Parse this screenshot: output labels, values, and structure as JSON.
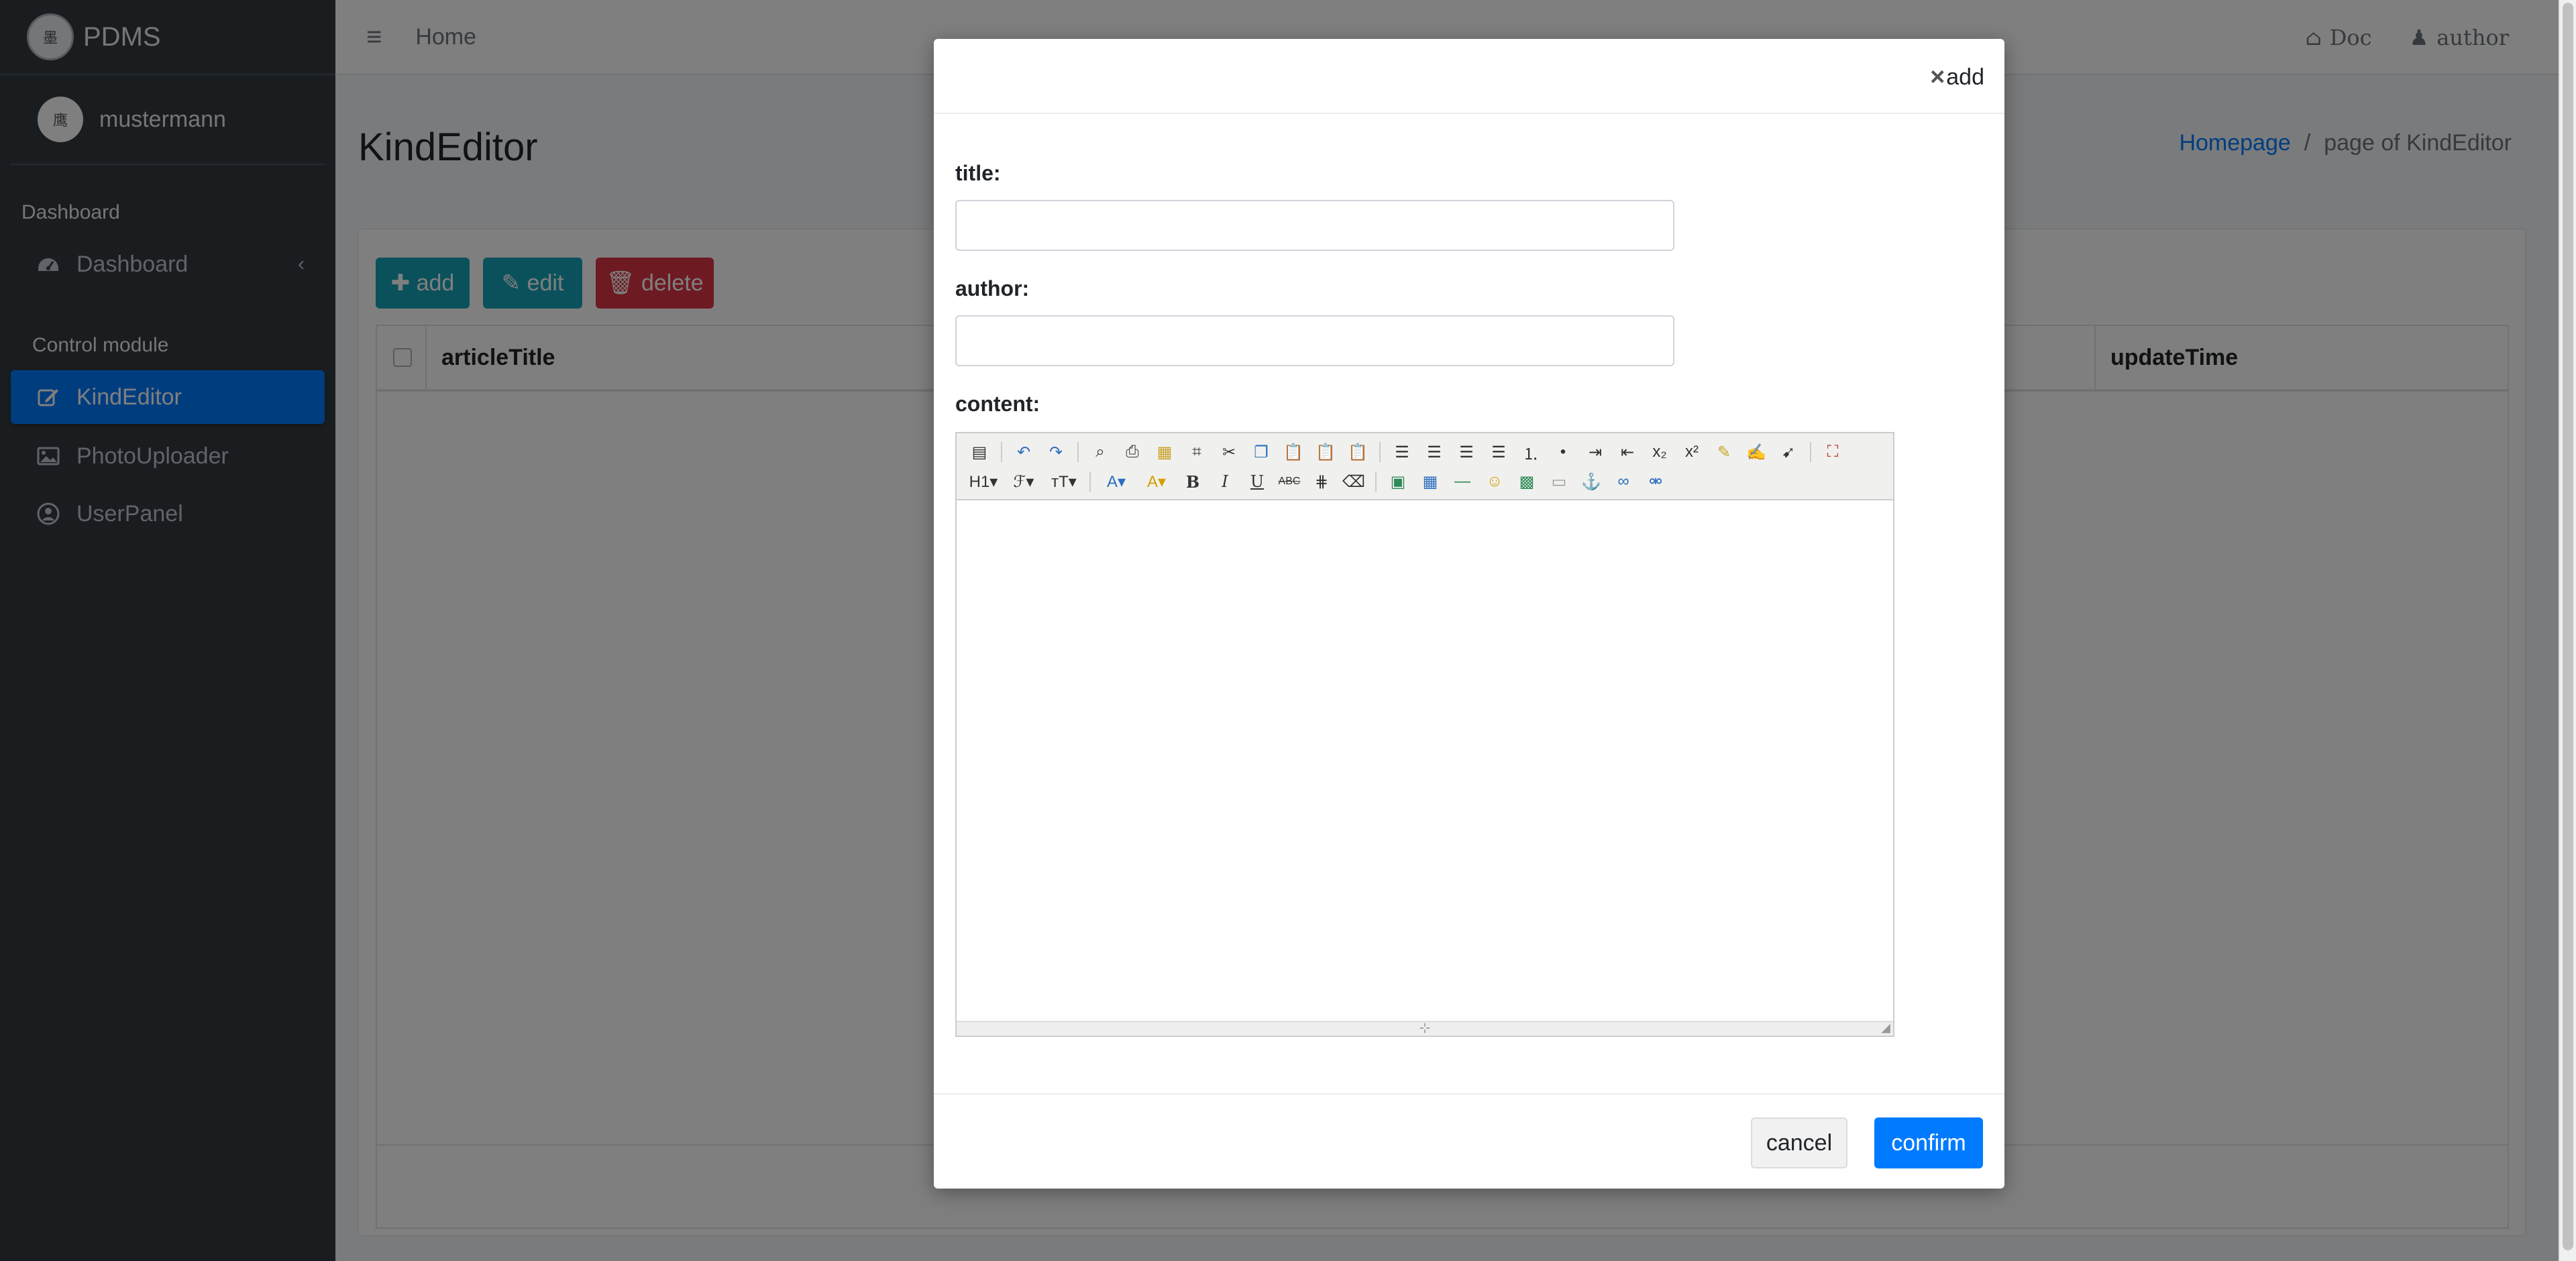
{
  "brand": {
    "name": "PDMS",
    "logo_text": "墨"
  },
  "user": {
    "name": "mustermann",
    "avatar_text": "鹰"
  },
  "sidebar": {
    "section_dashboard": "Dashboard",
    "section_control": "Control module",
    "items": [
      {
        "label": "Dashboard",
        "icon": "dashboard-icon"
      },
      {
        "label": "KindEditor",
        "icon": "edit-icon"
      },
      {
        "label": "PhotoUploader",
        "icon": "image-icon"
      },
      {
        "label": "UserPanel",
        "icon": "user-circle-icon"
      }
    ]
  },
  "topbar": {
    "home": "Home",
    "doc": "Doc",
    "author": "author"
  },
  "page": {
    "title": "KindEditor",
    "breadcrumb_home": "Homepage",
    "breadcrumb_sep": "/",
    "breadcrumb_current": "page of KindEditor"
  },
  "toolbar": {
    "add": "add",
    "edit": "edit",
    "delete": "delete"
  },
  "table": {
    "columns": [
      "articleTitle",
      "updateTime"
    ]
  },
  "modal": {
    "title": "add",
    "labels": {
      "title": "title:",
      "author": "author:",
      "content": "content:"
    },
    "values": {
      "title": "",
      "author": ""
    },
    "cancel": "cancel",
    "confirm": "confirm"
  },
  "editor_toolbar": {
    "row1": [
      "source",
      "undo",
      "redo",
      "preview",
      "print",
      "template",
      "code",
      "cut",
      "copy",
      "paste",
      "plainpaste",
      "wordpaste",
      "justifyleft",
      "justifycenter",
      "justifyright",
      "justifyfull",
      "insertorderedlist",
      "insertunorderedlist",
      "indent",
      "outdent",
      "subscript",
      "superscript",
      "clearhtml",
      "quickformat",
      "selectall",
      "fullscreen"
    ],
    "row2": [
      "formatblock",
      "fontname",
      "fontsize",
      "forecolor",
      "hilitecolor",
      "bold",
      "italic",
      "underline",
      "strikethrough",
      "lineheight",
      "removeformat",
      "image",
      "table",
      "hr",
      "emoticons",
      "baidumap",
      "pagebreak",
      "anchor",
      "link",
      "unlink"
    ]
  },
  "colors": {
    "sidebar_bg": "#343a40",
    "accent": "#007bff",
    "info": "#17a2b8",
    "danger": "#dc3545"
  }
}
